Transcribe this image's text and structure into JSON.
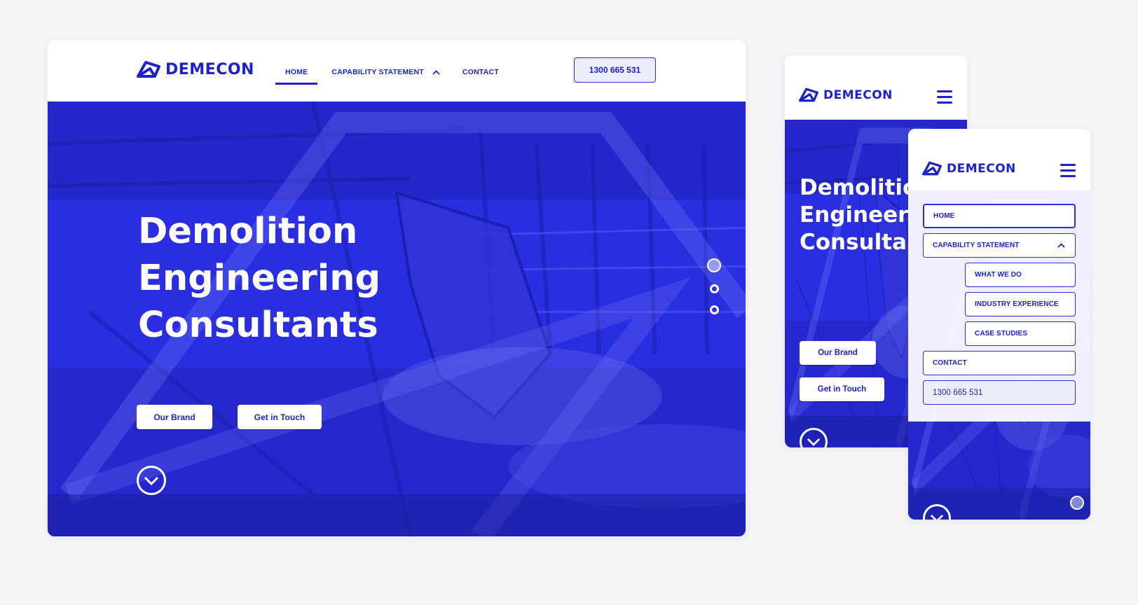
{
  "brand": {
    "name": "DEMECON",
    "primary_color": "#1d22c8",
    "hero_color": "#2a2ee0"
  },
  "nav": {
    "items": [
      {
        "label": "HOME"
      },
      {
        "label": "CAPABILITY STATEMENT"
      },
      {
        "label": "CONTACT"
      }
    ],
    "phone": "1300 665 531"
  },
  "hero": {
    "title_line1": "Demolition",
    "title_line2": "Engineering",
    "title_line3": "Consultants",
    "button_brand": "Our Brand",
    "button_touch": "Get in Touch"
  },
  "mobile_menu": {
    "home": "HOME",
    "capability": "CAPABILITY STATEMENT",
    "sub_items": [
      "WHAT WE DO",
      "INDUSTRY EXPERIENCE",
      "CASE STUDIES"
    ],
    "contact": "CONTACT",
    "phone": "1300 665 531"
  },
  "icons": [
    "logo-icon",
    "chevron-up-icon",
    "hamburger-icon",
    "chevron-down-circle-icon",
    "slider-dot-icon"
  ]
}
